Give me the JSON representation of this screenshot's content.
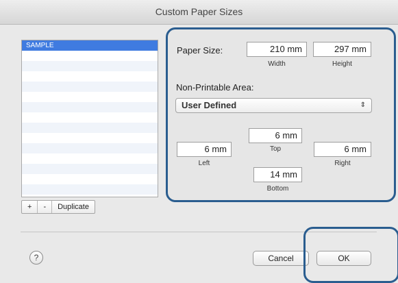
{
  "window": {
    "title": "Custom Paper Sizes"
  },
  "paper_list": {
    "items": [
      "SAMPLE"
    ],
    "selected": "SAMPLE"
  },
  "list_buttons": {
    "add": "+",
    "remove": "-",
    "duplicate": "Duplicate"
  },
  "paper_size": {
    "label": "Paper Size:",
    "width_value": "210 mm",
    "width_label": "Width",
    "height_value": "297 mm",
    "height_label": "Height"
  },
  "non_printable": {
    "label": "Non-Printable Area:",
    "selected": "User Defined",
    "top_value": "6 mm",
    "top_label": "Top",
    "left_value": "6 mm",
    "left_label": "Left",
    "right_value": "6 mm",
    "right_label": "Right",
    "bottom_value": "14 mm",
    "bottom_label": "Bottom"
  },
  "footer": {
    "help": "?",
    "cancel": "Cancel",
    "ok": "OK"
  },
  "colors": {
    "highlight": "#2a5d8f",
    "selection": "#3f7be0"
  }
}
